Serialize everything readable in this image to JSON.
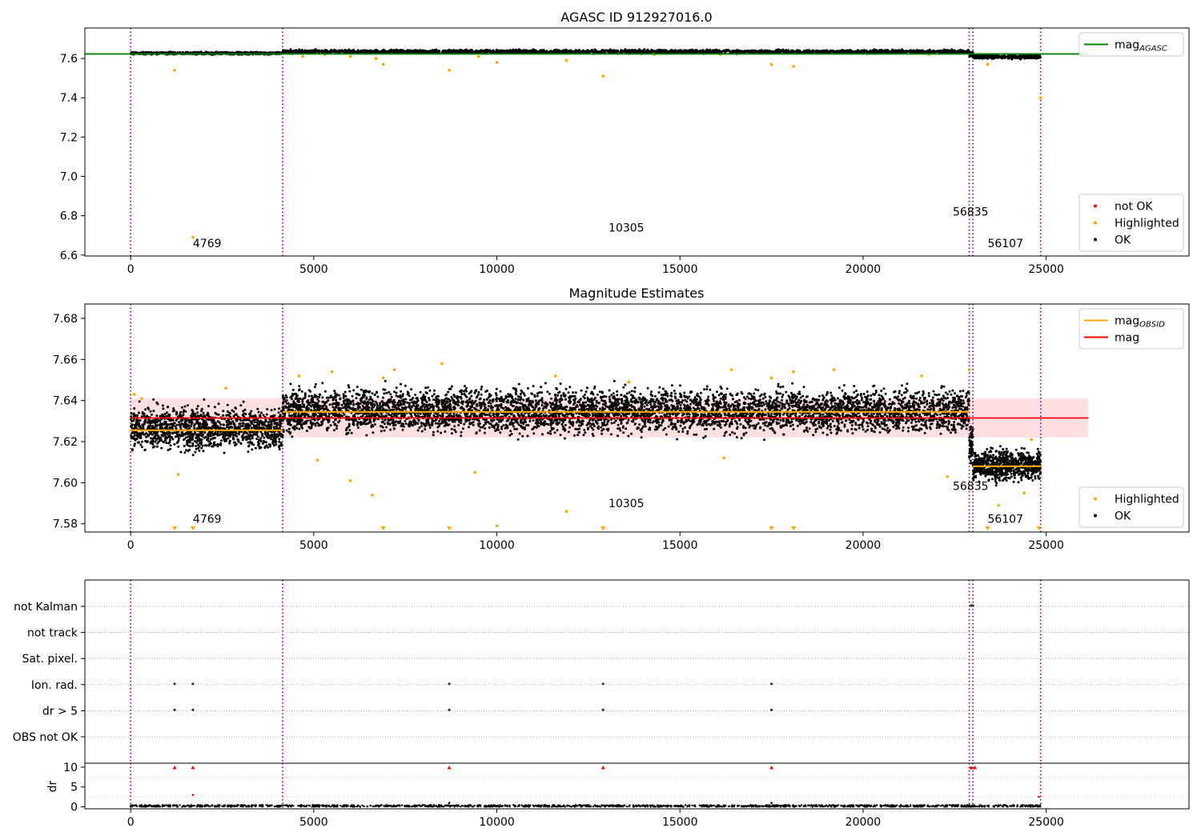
{
  "chart_data": [
    {
      "id": "agasc",
      "type": "scatter",
      "title": "AGASC ID 912927016.0",
      "xlim": [
        -1250,
        28900
      ],
      "ylim": [
        6.595,
        7.755
      ],
      "xticks": [
        0,
        5000,
        10000,
        15000,
        20000,
        25000
      ],
      "yticks": [
        6.6,
        6.8,
        7.0,
        7.2,
        7.4,
        7.6
      ],
      "ytick_decimals": 1,
      "obs_boundaries": [
        0,
        4150,
        22900,
        23000,
        24850
      ],
      "obs_labels": [
        {
          "text": "4769",
          "x": 1700,
          "y": 6.64
        },
        {
          "text": "10305",
          "x": 13050,
          "y": 6.72
        },
        {
          "text": "56835",
          "x": 22450,
          "y": 6.8
        },
        {
          "text": "56107",
          "x": 23400,
          "y": 6.64
        }
      ],
      "reference_lines": [
        {
          "name": "mag_AGASC",
          "value": 7.623,
          "x_range": [
            -1250,
            26150
          ],
          "color": "#008000"
        }
      ],
      "ok_bands": [
        {
          "x": [
            0,
            4150
          ],
          "y": [
            7.618,
            7.635
          ],
          "n": 700
        },
        {
          "x": [
            4150,
            22900
          ],
          "y": [
            7.622,
            7.648
          ],
          "n": 2400
        },
        {
          "x": [
            22900,
            23000
          ],
          "y": [
            7.6,
            7.64
          ],
          "n": 40
        },
        {
          "x": [
            23000,
            24850
          ],
          "y": [
            7.595,
            7.622
          ],
          "n": 360
        }
      ],
      "highlighted_points": [
        [
          1200,
          7.54
        ],
        [
          1700,
          6.69
        ],
        [
          4700,
          7.61
        ],
        [
          5300,
          7.62
        ],
        [
          6000,
          7.61
        ],
        [
          6700,
          7.6
        ],
        [
          6900,
          7.57
        ],
        [
          8700,
          7.54
        ],
        [
          9500,
          7.61
        ],
        [
          10000,
          7.58
        ],
        [
          11900,
          7.59
        ],
        [
          12900,
          7.51
        ],
        [
          14300,
          7.62
        ],
        [
          16100,
          7.62
        ],
        [
          17500,
          7.57
        ],
        [
          18100,
          7.56
        ],
        [
          21800,
          7.62
        ],
        [
          23400,
          7.57
        ],
        [
          24850,
          7.4
        ]
      ],
      "legends": [
        {
          "position": "upper-right",
          "entries": [
            {
              "kind": "line",
              "color": "#008000",
              "label": "mag",
              "sub": "AGASC"
            }
          ]
        },
        {
          "position": "lower-right",
          "entries": [
            {
              "kind": "dot",
              "color": "#ff0000",
              "label": "not OK"
            },
            {
              "kind": "dot",
              "color": "#ffa500",
              "label": "Highlighted"
            },
            {
              "kind": "dot",
              "color": "#000000",
              "label": "OK"
            }
          ]
        }
      ]
    },
    {
      "id": "magnitude",
      "type": "scatter",
      "title": "Magnitude Estimates",
      "xlim": [
        -1250,
        28900
      ],
      "ylim": [
        7.576,
        7.687
      ],
      "xticks": [
        0,
        5000,
        10000,
        15000,
        20000,
        25000
      ],
      "yticks": [
        7.58,
        7.6,
        7.62,
        7.64,
        7.66,
        7.68
      ],
      "ytick_decimals": 2,
      "obs_boundaries": [
        0,
        4150,
        22900,
        23000,
        24850
      ],
      "obs_labels": [
        {
          "text": "4769",
          "x": 1700,
          "y": 7.5805
        },
        {
          "text": "10305",
          "x": 13050,
          "y": 7.588
        },
        {
          "text": "56835",
          "x": 22450,
          "y": 7.5965
        },
        {
          "text": "56107",
          "x": 23400,
          "y": 7.5805
        }
      ],
      "mag_band": {
        "x_range": [
          0,
          26150
        ],
        "y": [
          7.622,
          7.641
        ],
        "color": "#ff0000"
      },
      "reference_lines": [
        {
          "name": "mag",
          "value": 7.6315,
          "x_range": [
            0,
            26150
          ],
          "color": "#ff0000"
        }
      ],
      "obsid_segments": [
        {
          "x": [
            0,
            4150
          ],
          "value": 7.6255
        },
        {
          "x": [
            4150,
            22900
          ],
          "value": 7.6345
        },
        {
          "x": [
            23000,
            24850
          ],
          "value": 7.608
        }
      ],
      "ok_bands": [
        {
          "x": [
            0,
            4150
          ],
          "y": [
            7.612,
            7.641
          ],
          "n": 1300
        },
        {
          "x": [
            4150,
            22900
          ],
          "y": [
            7.62,
            7.65
          ],
          "n": 5200
        },
        {
          "x": [
            22900,
            23000
          ],
          "y": [
            7.605,
            7.632
          ],
          "n": 60
        },
        {
          "x": [
            23000,
            24850
          ],
          "y": [
            7.598,
            7.619
          ],
          "n": 700
        }
      ],
      "highlighted_points": [
        [
          100,
          7.643
        ],
        [
          300,
          7.641
        ],
        [
          1300,
          7.604
        ],
        [
          2600,
          7.646
        ],
        [
          4600,
          7.652
        ],
        [
          5100,
          7.611
        ],
        [
          5500,
          7.654
        ],
        [
          6000,
          7.601
        ],
        [
          6600,
          7.594
        ],
        [
          6900,
          7.651
        ],
        [
          7200,
          7.655
        ],
        [
          8500,
          7.658
        ],
        [
          9400,
          7.605
        ],
        [
          10000,
          7.579
        ],
        [
          11600,
          7.652
        ],
        [
          11900,
          7.586
        ],
        [
          13600,
          7.649
        ],
        [
          16200,
          7.612
        ],
        [
          16400,
          7.655
        ],
        [
          17500,
          7.651
        ],
        [
          18100,
          7.654
        ],
        [
          19200,
          7.655
        ],
        [
          21600,
          7.652
        ],
        [
          22300,
          7.603
        ],
        [
          22900,
          7.655
        ],
        [
          23700,
          7.589
        ],
        [
          24400,
          7.595
        ],
        [
          24600,
          7.621
        ]
      ],
      "offscale_markers_x": [
        1200,
        1700,
        6900,
        8700,
        12900,
        17500,
        18100,
        23400,
        24800
      ],
      "legends": [
        {
          "position": "upper-right",
          "entries": [
            {
              "kind": "line",
              "color": "#ffa500",
              "label": "mag",
              "sub": "OBSID"
            },
            {
              "kind": "line",
              "color": "#ff0000",
              "label": "mag",
              "sub": ""
            }
          ]
        },
        {
          "position": "lower-right",
          "entries": [
            {
              "kind": "dot",
              "color": "#ffa500",
              "label": "Highlighted"
            },
            {
              "kind": "dot",
              "color": "#000000",
              "label": "OK"
            }
          ]
        }
      ]
    },
    {
      "id": "flags",
      "type": "scatter",
      "xlim": [
        -1250,
        28900
      ],
      "categories": [
        "not Kalman",
        "not track",
        "Sat. pixel.",
        "Ion. rad.",
        "dr > 5",
        "OBS not OK"
      ],
      "obs_boundaries": [
        0,
        4150,
        22900,
        23000,
        24850
      ],
      "flag_points": [
        {
          "category": "not Kalman",
          "x": [
            22950,
            23000
          ]
        },
        {
          "category": "Ion. rad.",
          "x": [
            1200,
            1700,
            8700,
            12900,
            17500
          ]
        },
        {
          "category": "dr > 5",
          "x": [
            1200,
            1700,
            8700,
            12900,
            17500
          ]
        }
      ]
    },
    {
      "id": "dr",
      "type": "scatter",
      "ylabel": "dr",
      "xlim": [
        -1250,
        28900
      ],
      "ylim": [
        -0.5,
        11
      ],
      "xticks": [
        0,
        5000,
        10000,
        15000,
        20000,
        25000
      ],
      "yticks": [
        0,
        5,
        10
      ],
      "ytick_decimals": 0,
      "obs_boundaries": [
        0,
        4150,
        22900,
        23000,
        24850
      ],
      "clipped_markers_x": [
        1200,
        1700,
        8700,
        12900,
        17500,
        22950,
        23050
      ],
      "outlier_points": [
        [
          1700,
          3.0
        ],
        [
          8700,
          1.0
        ],
        [
          17500,
          1.0
        ],
        [
          24800,
          2.5
        ]
      ]
    }
  ]
}
